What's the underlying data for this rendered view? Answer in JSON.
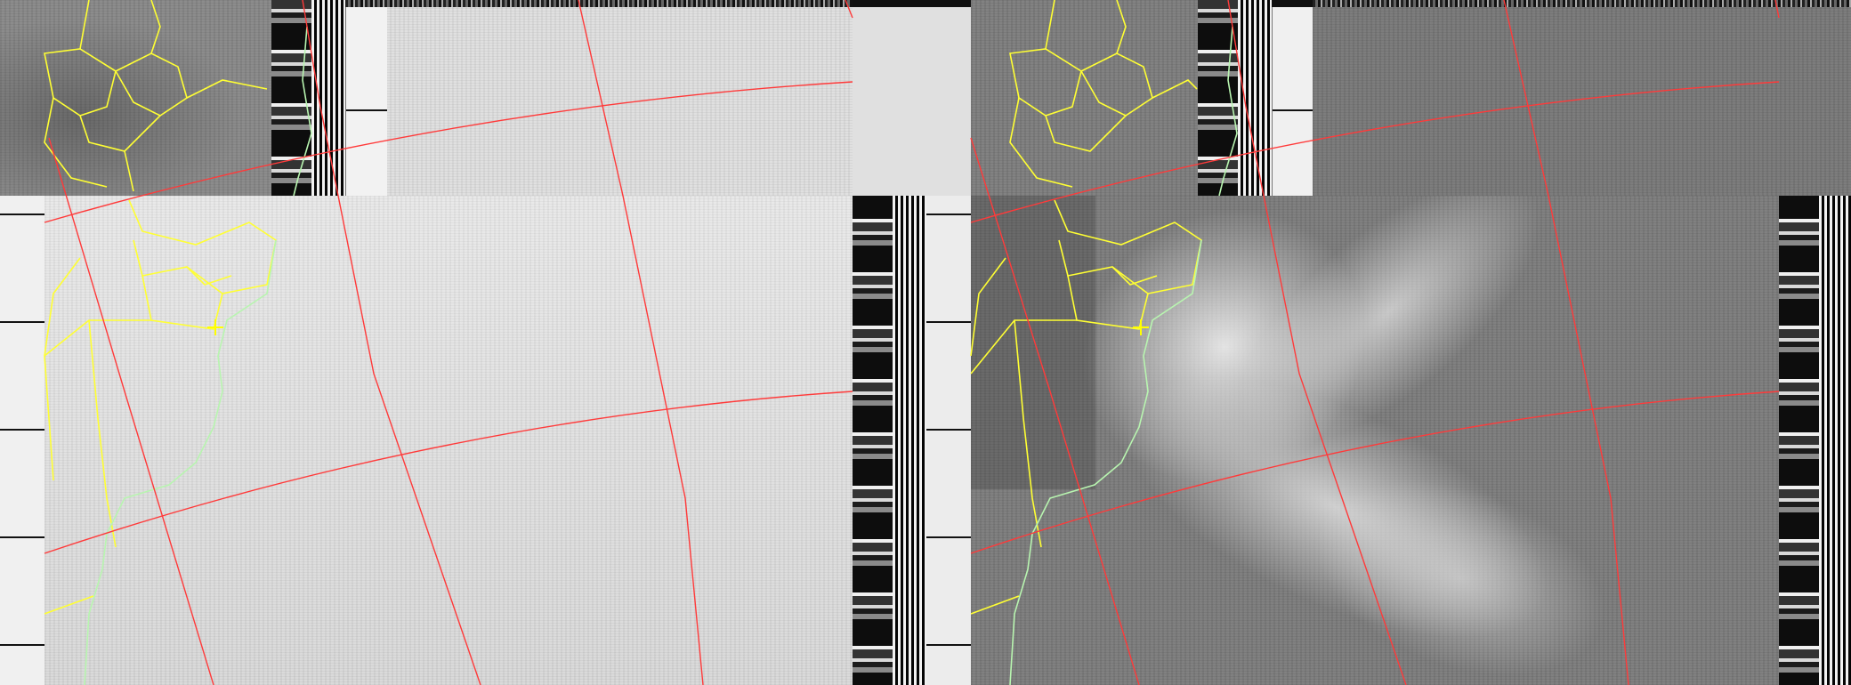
{
  "image": {
    "kind": "apt-weather-satellite-image",
    "panels": [
      {
        "id": "left",
        "channel_style": "visible-washed-light-gray"
      },
      {
        "id": "right",
        "channel_style": "infrared-dark-gray-clouds"
      }
    ],
    "colors": {
      "graticule": "#ff3a3a",
      "political_borders": "#ffff33",
      "coastline": "#b8f5b0",
      "location_marker": "#ffff00",
      "left_background": "#e6e6e6",
      "right_background": "#7a7a7a",
      "cloud_white": "#f3f3f3"
    },
    "icons": {
      "location_marker": "plus-marker-icon"
    }
  }
}
